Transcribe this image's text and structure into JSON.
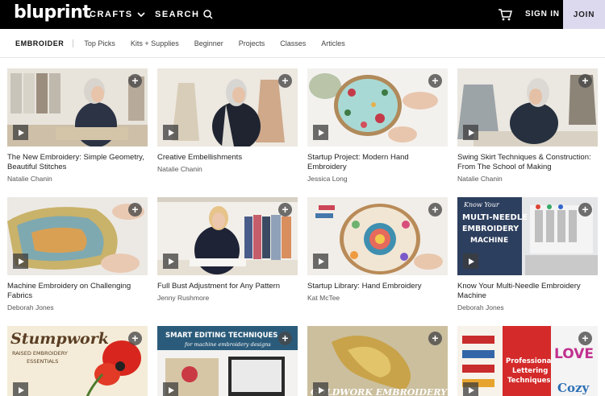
{
  "header": {
    "logo": "bluprint",
    "crafts": "CRAFTS",
    "search": "SEARCH",
    "signin": "SIGN IN",
    "join": "JOIN"
  },
  "subnav": {
    "active": "EMBROIDER",
    "items": [
      "Top Picks",
      "Kits + Supplies",
      "Beginner",
      "Projects",
      "Classes",
      "Articles"
    ]
  },
  "cards": [
    {
      "title": "The New Embroidery: Simple Geometry, Beautiful Stitches",
      "author": "Natalie Chanin"
    },
    {
      "title": "Creative Embellishments",
      "author": "Natalie Chanin"
    },
    {
      "title": "Startup Project: Modern Hand Embroidery",
      "author": "Jessica Long"
    },
    {
      "title": "Swing Skirt Techniques & Construction: From The School of Making",
      "author": "Natalie Chanin"
    },
    {
      "title": "Machine Embroidery on Challenging Fabrics",
      "author": "Deborah Jones"
    },
    {
      "title": "Full Bust Adjustment for Any Pattern",
      "author": "Jenny Rushmore"
    },
    {
      "title": "Startup Library: Hand Embroidery",
      "author": "Kat McTee"
    },
    {
      "title": "Know Your Multi-Needle Embroidery Machine",
      "author": "Deborah Jones"
    }
  ],
  "thumb_text": {
    "multi_needle": [
      "Know Your",
      "MULTI-NEEDLE",
      "EMBROIDERY",
      "MACHINE"
    ],
    "stumpwork": [
      "Stumpwork",
      "RAISED EMBROIDERY",
      "ESSENTIALS"
    ],
    "smart_editing": [
      "SMART EDITING TECHNIQUES",
      "for machine embroidery designs"
    ],
    "goldwork": "GOLDWORK EMBROIDERY",
    "lettering": [
      "Professional",
      "Lettering",
      "Techniques"
    ],
    "love": "LOVE",
    "cozy": "Cozy"
  }
}
